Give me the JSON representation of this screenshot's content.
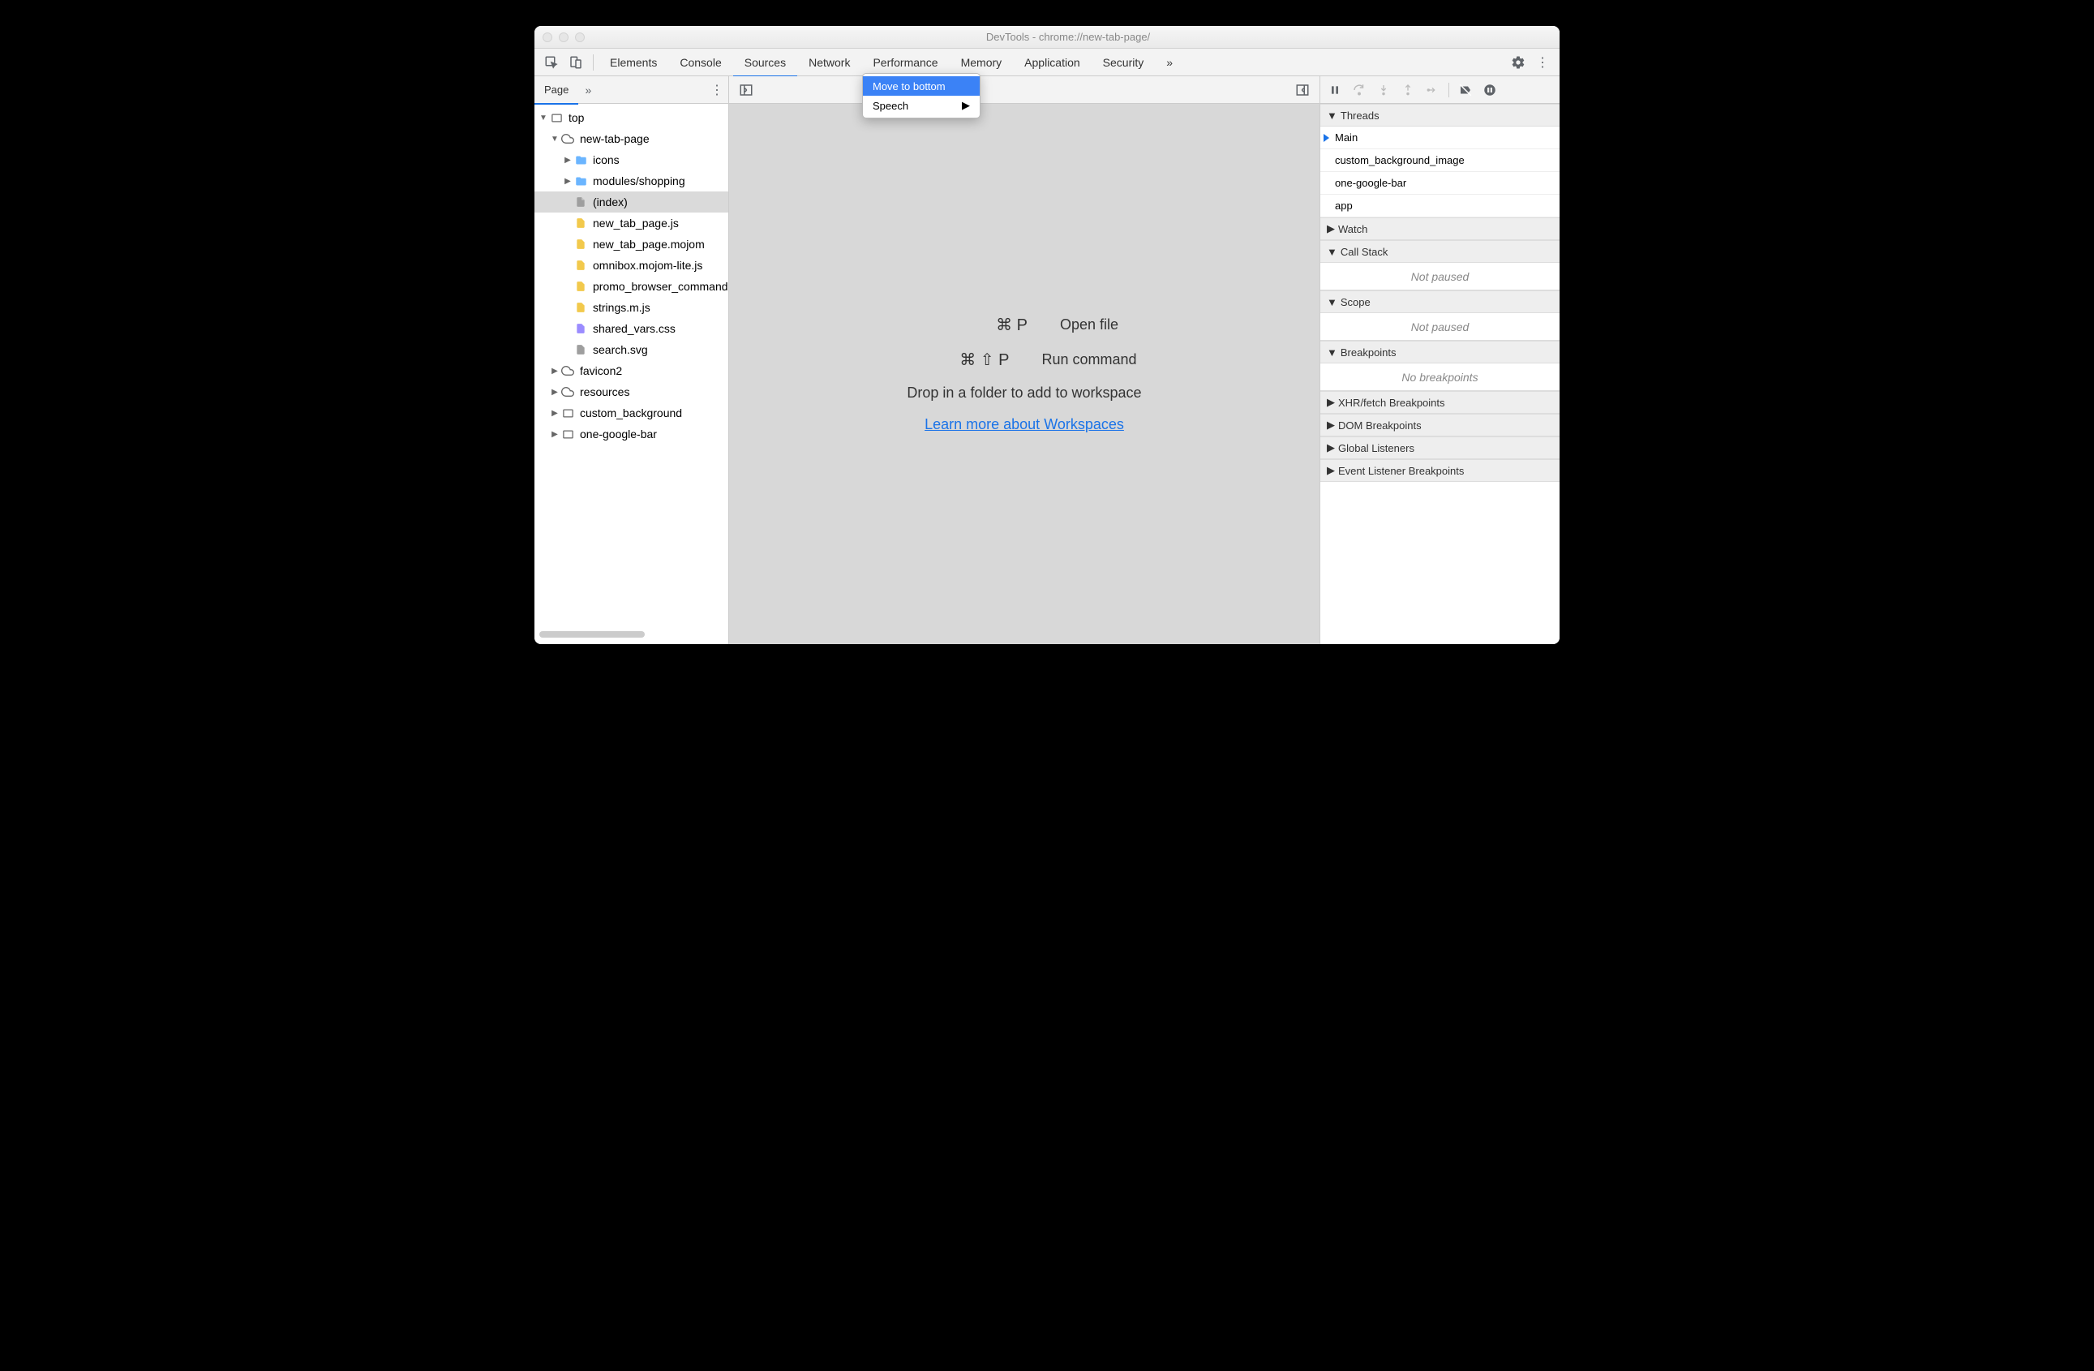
{
  "window_title": "DevTools - chrome://new-tab-page/",
  "tabs": [
    "Elements",
    "Console",
    "Sources",
    "Network",
    "Performance",
    "Memory",
    "Application",
    "Security"
  ],
  "active_tab": "Sources",
  "sidebar": {
    "tab": "Page"
  },
  "tree": {
    "top": "top",
    "ntp": "new-tab-page",
    "icons": "icons",
    "modules": "modules/shopping",
    "index": "(index)",
    "js1": "new_tab_page.js",
    "js2": "new_tab_page.mojom",
    "js3": "omnibox.mojom-lite.js",
    "js4": "promo_browser_command",
    "js5": "strings.m.js",
    "css1": "shared_vars.css",
    "svg1": "search.svg",
    "fav": "favicon2",
    "res": "resources",
    "cbg": "custom_background",
    "ogb": "one-google-bar"
  },
  "context_menu": {
    "move": "Move to bottom",
    "speech": "Speech"
  },
  "center": {
    "k1": "⌘ P",
    "a1": "Open file",
    "k2": "⌘ ⇧ P",
    "a2": "Run command",
    "drop": "Drop in a folder to add to workspace",
    "link": "Learn more about Workspaces"
  },
  "right": {
    "threads_h": "Threads",
    "threads": [
      "Main",
      "custom_background_image",
      "one-google-bar",
      "app"
    ],
    "watch": "Watch",
    "callstack": "Call Stack",
    "not_paused": "Not paused",
    "scope": "Scope",
    "breakpoints": "Breakpoints",
    "no_bp": "No breakpoints",
    "xhr": "XHR/fetch Breakpoints",
    "dom": "DOM Breakpoints",
    "gl": "Global Listeners",
    "el": "Event Listener Breakpoints"
  }
}
